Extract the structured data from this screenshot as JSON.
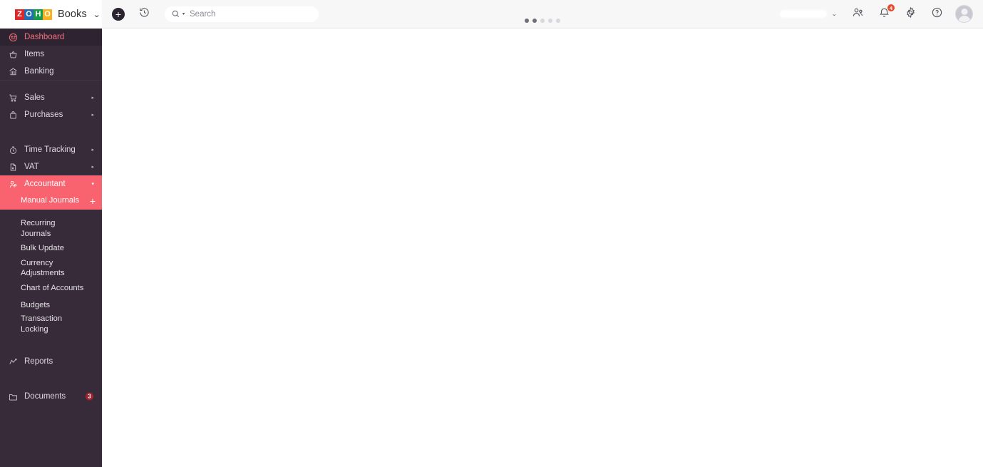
{
  "brand": {
    "logo_letters": [
      "Z",
      "O",
      "H",
      "O"
    ],
    "word": "Books",
    "caret": "⌄",
    "colors": {
      "z": "#e42527",
      "o1": "#226db4",
      "h": "#179b49",
      "o2": "#f9b21d"
    }
  },
  "theme": {
    "sidebar_bg": "#372b3a",
    "accent": "#f8636f",
    "active_bg": "#2e2431",
    "active_text": "#f3707c",
    "topbar_bg": "#f7f7f8",
    "badge_red": "#a22430",
    "notification_red": "#e8492b"
  },
  "sidebar": {
    "items": [
      {
        "label": "Dashboard",
        "icon": "dashboard-gauge-icon",
        "state": "active"
      },
      {
        "label": "Items",
        "icon": "basket-icon",
        "state": "default"
      },
      {
        "label": "Banking",
        "icon": "bank-icon",
        "state": "default"
      },
      {
        "label": "Sales",
        "icon": "shopping-cart-icon",
        "state": "expandable",
        "arrow": "▸"
      },
      {
        "label": "Purchases",
        "icon": "bag-icon",
        "state": "expandable",
        "arrow": "▸"
      },
      {
        "label": "Time Tracking",
        "icon": "stopwatch-icon",
        "state": "expandable",
        "arrow": "▸"
      },
      {
        "label": "VAT",
        "icon": "tax-document-icon",
        "state": "expandable",
        "arrow": "▸"
      },
      {
        "label": "Accountant",
        "icon": "accountant-person-icon",
        "state": "accent-expanded",
        "arrow": "▾"
      },
      {
        "label": "Reports",
        "icon": "chart-line-icon",
        "state": "default"
      },
      {
        "label": "Documents",
        "icon": "folder-icon",
        "state": "default",
        "badge": "3"
      }
    ],
    "accountant_submenu": [
      {
        "label": "Manual Journals",
        "state": "accent",
        "action_icon": "plus-icon",
        "action_label": "+"
      },
      {
        "label": "Recurring Journals",
        "state": "default"
      },
      {
        "label": "Bulk Update",
        "state": "default"
      },
      {
        "label": "Currency Adjustments",
        "state": "default",
        "two_line": true
      },
      {
        "label": "Chart of Accounts",
        "state": "default"
      },
      {
        "label": "Budgets",
        "state": "default"
      },
      {
        "label": "Transaction Locking",
        "state": "default"
      }
    ]
  },
  "topbar": {
    "add_label": "+",
    "add_icon": "plus-circle-icon",
    "history_icon": "recent-history-clock-icon",
    "search": {
      "icon": "search-icon",
      "caret": "▾",
      "placeholder": "Search",
      "value": ""
    },
    "loader": {
      "icon": "loading-dots-indicator",
      "total_dots": 5,
      "active_dots": 2
    },
    "org_switcher": {
      "label": "",
      "redacted": true,
      "caret": "⌄"
    },
    "actions": [
      {
        "icon": "contacts-users-icon",
        "label": "Contacts"
      },
      {
        "icon": "notification-bell-icon",
        "label": "Notifications",
        "badge": "4"
      },
      {
        "icon": "gear-settings-icon",
        "label": "Settings"
      },
      {
        "icon": "help-question-icon",
        "label": "Help"
      }
    ],
    "avatar": {
      "icon": "user-avatar",
      "label": "Profile"
    }
  },
  "main": {
    "content": ""
  }
}
